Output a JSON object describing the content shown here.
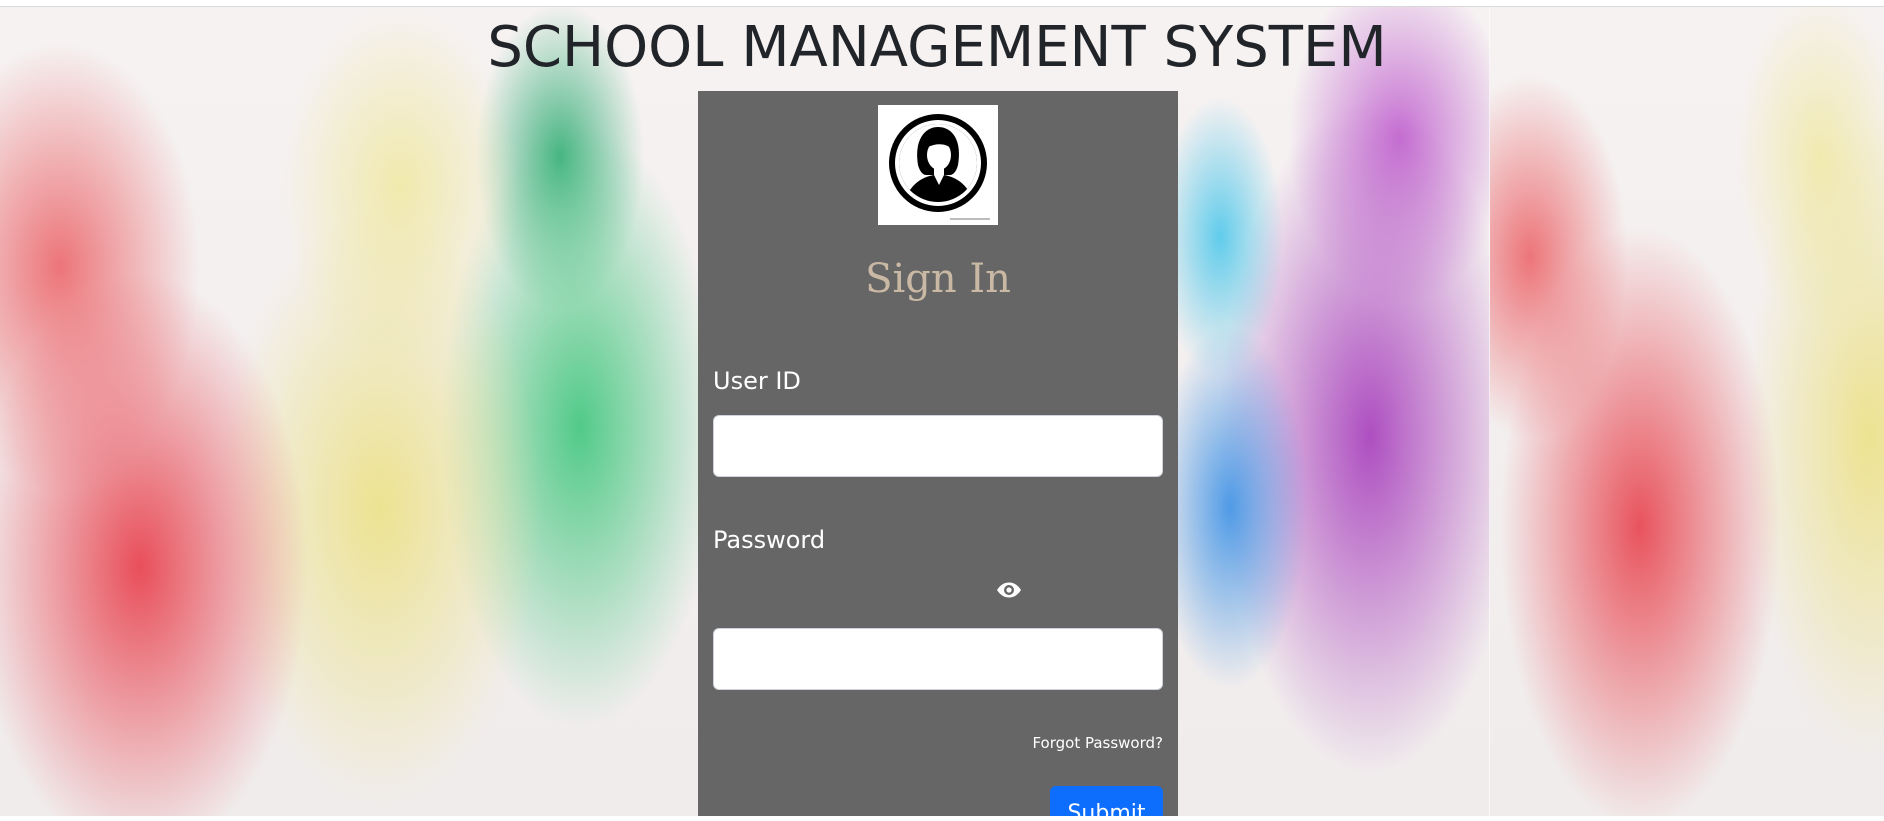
{
  "header": {
    "title": "SCHOOL MANAGEMENT SYSTEM"
  },
  "login": {
    "heading": "Sign In",
    "user_id_label": "User ID",
    "user_id_value": "",
    "password_label": "Password",
    "password_value": "",
    "forgot_password": "Forgot Password?",
    "submit_label": "Submit",
    "avatar_icon": "female-user-avatar-icon",
    "toggle_icon": "eye-icon"
  },
  "colors": {
    "card_background": "#666666",
    "heading": "#c9b9a4",
    "submit_button": "#0d6efd",
    "title": "#212529"
  }
}
